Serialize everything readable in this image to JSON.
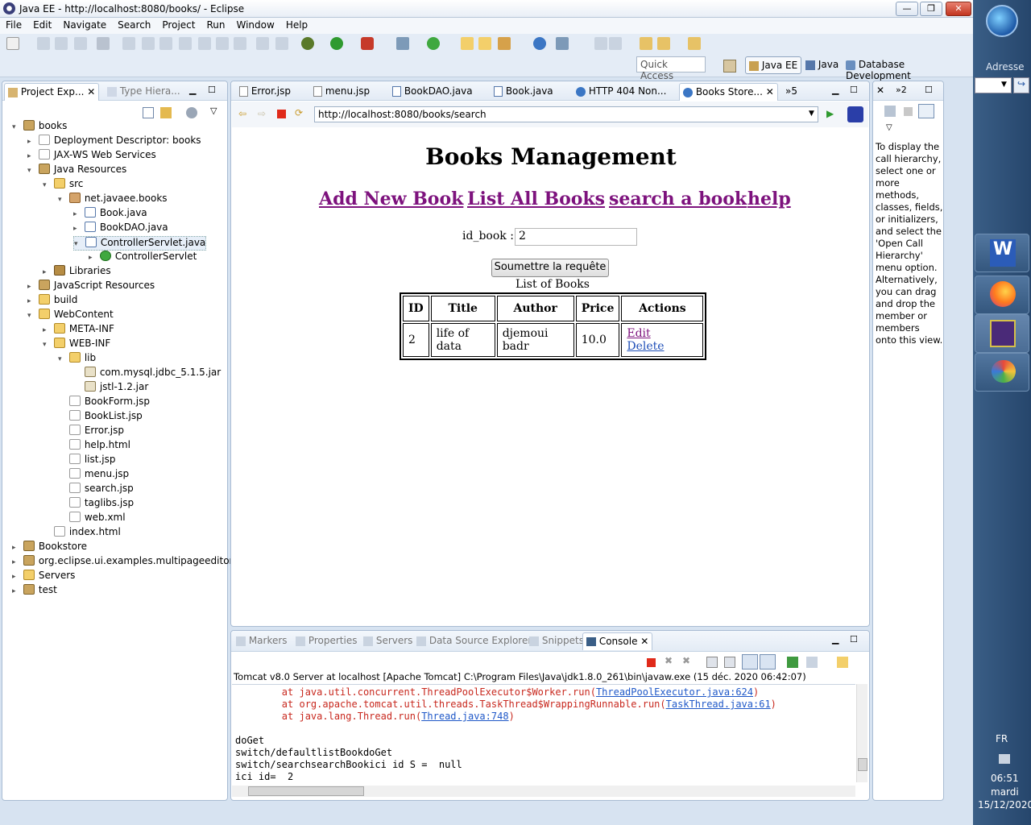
{
  "window": {
    "title": "Java EE - http://localhost:8080/books/ - Eclipse",
    "min": "—",
    "max": "❐",
    "close": "✕"
  },
  "menu": [
    "File",
    "Edit",
    "Navigate",
    "Search",
    "Project",
    "Run",
    "Window",
    "Help"
  ],
  "quick_access": "Quick Access",
  "perspectives": {
    "javaee": "Java EE",
    "java": "Java",
    "db": "Database Development"
  },
  "left_tabs": {
    "project_explorer": "Project Exp...",
    "type_hierarchy": "Type Hiera..."
  },
  "tree": [
    {
      "label": "books",
      "level": 0,
      "twist": "▾",
      "icon": "project-icon"
    },
    {
      "label": "Deployment Descriptor: books",
      "level": 1,
      "twist": "▸",
      "icon": "descriptor-icon"
    },
    {
      "label": "JAX-WS Web Services",
      "level": 1,
      "twist": "▸",
      "icon": "webservice-icon"
    },
    {
      "label": "Java Resources",
      "level": 1,
      "twist": "▾",
      "icon": "java-resources-icon"
    },
    {
      "label": "src",
      "level": 2,
      "twist": "▾",
      "icon": "source-folder-icon"
    },
    {
      "label": "net.javaee.books",
      "level": 3,
      "twist": "▾",
      "icon": "package-icon"
    },
    {
      "label": "Book.java",
      "level": 4,
      "twist": "▸",
      "icon": "java-file-icon"
    },
    {
      "label": "BookDAO.java",
      "level": 4,
      "twist": "▸",
      "icon": "java-file-icon"
    },
    {
      "label": "ControllerServlet.java",
      "level": 4,
      "twist": "▾",
      "icon": "java-file-icon",
      "selected": true
    },
    {
      "label": "ControllerServlet",
      "level": 5,
      "twist": "▸",
      "icon": "class-icon"
    },
    {
      "label": "Libraries",
      "level": 2,
      "twist": "▸",
      "icon": "libraries-icon"
    },
    {
      "label": "JavaScript Resources",
      "level": 1,
      "twist": "▸",
      "icon": "js-resources-icon"
    },
    {
      "label": "build",
      "level": 1,
      "twist": "▸",
      "icon": "folder-icon"
    },
    {
      "label": "WebContent",
      "level": 1,
      "twist": "▾",
      "icon": "folder-icon"
    },
    {
      "label": "META-INF",
      "level": 2,
      "twist": "▸",
      "icon": "folder-icon"
    },
    {
      "label": "WEB-INF",
      "level": 2,
      "twist": "▾",
      "icon": "folder-icon"
    },
    {
      "label": "lib",
      "level": 3,
      "twist": "▾",
      "icon": "folder-icon"
    },
    {
      "label": "com.mysql.jdbc_5.1.5.jar",
      "level": 4,
      "twist": "",
      "icon": "jar-icon"
    },
    {
      "label": "jstl-1.2.jar",
      "level": 4,
      "twist": "",
      "icon": "jar-icon"
    },
    {
      "label": "BookForm.jsp",
      "level": 3,
      "twist": "",
      "icon": "jsp-file-icon"
    },
    {
      "label": "BookList.jsp",
      "level": 3,
      "twist": "",
      "icon": "jsp-file-icon"
    },
    {
      "label": "Error.jsp",
      "level": 3,
      "twist": "",
      "icon": "jsp-file-icon"
    },
    {
      "label": "help.html",
      "level": 3,
      "twist": "",
      "icon": "html-file-icon"
    },
    {
      "label": "list.jsp",
      "level": 3,
      "twist": "",
      "icon": "jsp-file-icon"
    },
    {
      "label": "menu.jsp",
      "level": 3,
      "twist": "",
      "icon": "jsp-file-icon"
    },
    {
      "label": "search.jsp",
      "level": 3,
      "twist": "",
      "icon": "jsp-file-icon"
    },
    {
      "label": "taglibs.jsp",
      "level": 3,
      "twist": "",
      "icon": "jsp-file-icon"
    },
    {
      "label": "web.xml",
      "level": 3,
      "twist": "",
      "icon": "xml-file-icon"
    },
    {
      "label": "index.html",
      "level": 2,
      "twist": "",
      "icon": "html-file-icon"
    },
    {
      "label": "Bookstore",
      "level": 0,
      "twist": "▸",
      "icon": "project-icon"
    },
    {
      "label": "org.eclipse.ui.examples.multipageeditor",
      "level": 0,
      "twist": "▸",
      "icon": "project-icon"
    },
    {
      "label": "Servers",
      "level": 0,
      "twist": "▸",
      "icon": "folder-icon"
    },
    {
      "label": "test",
      "level": 0,
      "twist": "▸",
      "icon": "project-icon"
    }
  ],
  "editor_tabs": [
    "Error.jsp",
    "menu.jsp",
    "BookDAO.java",
    "Book.java",
    "HTTP 404 Non...",
    "Books Store..."
  ],
  "editor_overflow": "»5",
  "browser": {
    "url": "http://localhost:8080/books/search",
    "heading": "Books Management",
    "links": [
      "Add New Book",
      "List All Books",
      "search a book",
      "help"
    ],
    "field_label": "id_book :",
    "field_value": "2",
    "submit": "Soumettre la requête",
    "caption": "List of Books",
    "table": {
      "headers": [
        "ID",
        "Title",
        "Author",
        "Price",
        "Actions"
      ],
      "rows": [
        {
          "id": "2",
          "title": "life of data",
          "author": "djemoui badr",
          "price": "10.0",
          "edit": "Edit",
          "delete": "Delete"
        }
      ]
    }
  },
  "hierarchy": {
    "overflow": "»2",
    "help": "To display the call hierarchy, select one or more methods, classes, fields, or initializers, and select the 'Open Call Hierarchy' menu option. Alternatively, you can drag and drop the member or members onto this view."
  },
  "bottom_tabs": [
    "Markers",
    "Properties",
    "Servers",
    "Data Source Explorer",
    "Snippets",
    "Console"
  ],
  "console": {
    "header": "Tomcat v8.0 Server at localhost [Apache Tomcat] C:\\Program Files\\Java\\jdk1.8.0_261\\bin\\javaw.exe (15 déc. 2020 06:42:07)",
    "err1a": "        at java.util.concurrent.ThreadPoolExecutor$Worker.run(",
    "err1b": "ThreadPoolExecutor.java:624",
    "err2a": "        at org.apache.tomcat.util.threads.TaskThread$WrappingRunnable.run(",
    "err2b": "TaskThread.java:61",
    "err3a": "        at java.lang.Thread.run(",
    "err3b": "Thread.java:748",
    "close_paren": ")",
    "l1": "doGet",
    "l2": "switch/defaultlistBookdoGet",
    "l3": "switch/searchsearchBookici id S =  null",
    "l4": "ici id=  2"
  },
  "taskbar": {
    "address": "Adresse",
    "lang": "FR",
    "time": "06:51",
    "day": "mardi",
    "date": "15/12/2020"
  }
}
